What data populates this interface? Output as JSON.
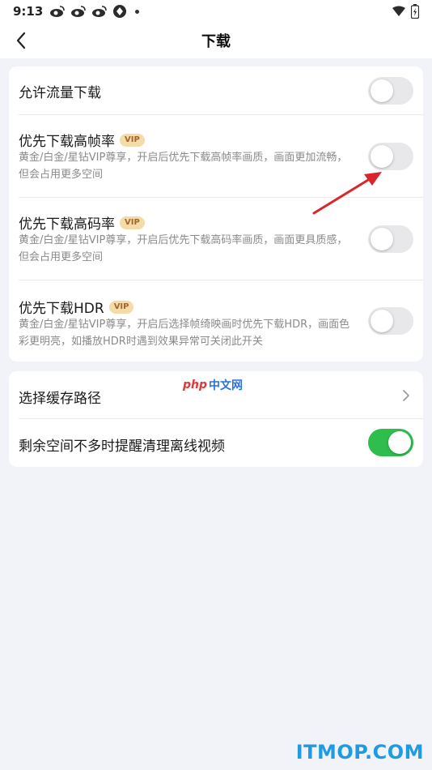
{
  "status_bar": {
    "time": "9:13",
    "left_icons": [
      "weibo-icon",
      "weibo-icon",
      "weibo-icon",
      "app-icon"
    ],
    "right_icons": [
      "wifi-icon",
      "battery-icon"
    ]
  },
  "header": {
    "title": "下载",
    "back_icon": "chevron-left-icon"
  },
  "settings_group_1": [
    {
      "title": "允许流量下载",
      "vip": false,
      "description": "",
      "toggle_on": false
    },
    {
      "title": "优先下载高帧率",
      "vip": true,
      "vip_label": "VIP",
      "description": "黄金/白金/星钻VIP尊享，开启后优先下载高帧率画质，画面更加流畅，但会占用更多空间",
      "toggle_on": false
    },
    {
      "title": "优先下载高码率",
      "vip": true,
      "vip_label": "VIP",
      "description": "黄金/白金/星钻VIP尊享，开启后优先下载高码率画质，画面更具质感，但会占用更多空间",
      "toggle_on": false
    },
    {
      "title": "优先下载HDR",
      "vip": true,
      "vip_label": "VIP",
      "description": "黄金/白金/星钻VIP尊享，开启后选择帧绮映画时优先下载HDR，画面色彩更明亮，如播放HDR时遇到效果异常可关闭此开关",
      "toggle_on": false
    }
  ],
  "settings_group_2": [
    {
      "title": "选择缓存路径",
      "type": "link",
      "icon": "chevron-right-icon"
    },
    {
      "title": "剩余空间不多时提醒清理离线视频",
      "type": "toggle",
      "toggle_on": true
    }
  ],
  "watermarks": {
    "php_part1": "php",
    "php_part2": "中文网",
    "itmop": "ITMOP.COM"
  },
  "colors": {
    "toggle_on": "#2fbd4e",
    "toggle_off": "#e8e8ea",
    "vip_bg": "#f4dcaa",
    "vip_text": "#a2652b",
    "page_bg": "#f1f3f8",
    "annotation_arrow": "#d9262c"
  }
}
